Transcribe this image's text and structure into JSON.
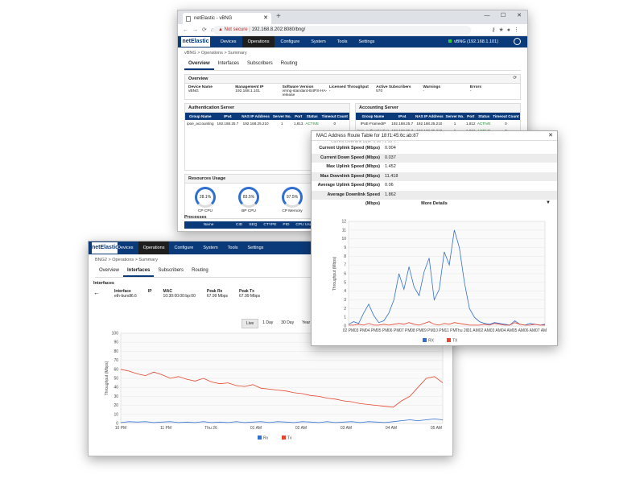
{
  "browser": {
    "tab_title": "netElastic - vBNG",
    "url_warning": "Not secure",
    "url": "192.168.8.202:8080/bng/"
  },
  "win1": {
    "logo": "netElastic",
    "menu": [
      "Devices",
      "Operations",
      "Configure",
      "System",
      "Tools",
      "Settings"
    ],
    "menu_active": 1,
    "device_link": "vBNG (192.168.1.101)",
    "breadcrumb": "vBNG > Operations > Summary",
    "tabs": [
      "Overview",
      "Interfaces",
      "Subscribers",
      "Routing"
    ],
    "overview_title": "Overview",
    "overview_cols": [
      {
        "label": "Device Name",
        "value": "vBNG"
      },
      {
        "label": "Management IP",
        "value": "192.168.1.101"
      },
      {
        "label": "Software Version",
        "value": "vmng-standard-B4PS-HA-release"
      },
      {
        "label": "Licensed Throughput",
        "value": "-"
      },
      {
        "label": "Active Subscribers",
        "value": "570"
      },
      {
        "label": "Warnings",
        "value": "-"
      },
      {
        "label": "Errors",
        "value": "-"
      }
    ],
    "auth_title": "Authentication Server",
    "auth_headers": [
      "Group Name",
      "IPv4",
      "NAS IP Address",
      "Server No.",
      "Port",
      "Status",
      "Timeout Count"
    ],
    "auth_rows": [
      [
        "ipoe_accounting",
        "192.168.25.7",
        "192.168.25.210",
        "1",
        "1,813",
        "ACTIVE",
        "0"
      ]
    ],
    "acct_title": "Accounting Server",
    "acct_headers": [
      "Group Name",
      "IPv4",
      "NAS IP Address",
      "Server No.",
      "Port",
      "Status",
      "Timeout Count"
    ],
    "acct_rows": [
      [
        "IPoE-FramedIP",
        "192.168.25.7",
        "192.168.25.210",
        "1",
        "1,812",
        "ACTIVE",
        "0"
      ],
      [
        "ipoe_authentication",
        "192.168.25.7",
        "192.168.25.210",
        "1",
        "1,812",
        "ACTIVE",
        "0"
      ]
    ],
    "resources_title": "Resources Usage",
    "gauges": [
      {
        "label": "CP CPU",
        "value": "28.1%"
      },
      {
        "label": "BP CPU",
        "value": "83.5%"
      },
      {
        "label": "CP Memory",
        "value": "97.5%"
      }
    ],
    "processes_title": "Processes",
    "process_headers": [
      "Name",
      "CID",
      "SEQ",
      "CTYPE",
      "PID",
      "CPU Usage (%)"
    ]
  },
  "win2": {
    "logo": "netElastic",
    "menu": [
      "Devices",
      "Operations",
      "Configure",
      "System",
      "Tools",
      "Settings"
    ],
    "menu_active": 1,
    "breadcrumb": "BNG2 > Operations > Summary",
    "tabs": [
      "Overview",
      "Interfaces",
      "Subscribers",
      "Routing"
    ],
    "section": "Interfaces",
    "iface_labels": [
      "Interface",
      "IP",
      "MAC",
      "Peak Rx",
      "Peak Tx"
    ],
    "iface_values": [
      "eth-bundl6.6",
      "",
      "10:30:00:00:bp:00",
      "67.99 Mbps",
      "67.99 Mbps"
    ],
    "ranges": [
      "Live",
      "1 Day",
      "30 Day",
      "Year"
    ],
    "range_active": 0
  },
  "win3": {
    "title": "MAC Address Route Table for 18:f1:45:6c:ab:87",
    "cut_text": "Current Downlink Byte: 0.00 71.18 T...",
    "stats": [
      {
        "label": "Current Uplink Speed (Mbps)",
        "value": "0.004"
      },
      {
        "label": "Current Down Speed (Mbps)",
        "value": "0.037"
      },
      {
        "label": "Max Uplink Speed (Mbps)",
        "value": "1.452"
      },
      {
        "label": "Max Downlink Speed (Mbps)",
        "value": "11.418"
      },
      {
        "label": "Average Uplink Speed (Mbps)",
        "value": "0.06"
      },
      {
        "label": "Average Downlink Speed (Mbps)",
        "value": "1.862"
      }
    ],
    "more_label": "More Details"
  },
  "chart_data": [
    {
      "type": "line",
      "title": "",
      "ylabel": "Throughput (Mbps)",
      "ylim": [
        0,
        100
      ],
      "yticks": [
        0,
        10,
        20,
        30,
        40,
        50,
        60,
        70,
        80,
        90,
        100
      ],
      "xtick_labels": [
        "10 PM",
        "11 PM",
        "Thu 26",
        "01 AM",
        "02 AM",
        "03 AM",
        "04 AM",
        "05 AM"
      ],
      "legend": [
        "Rx",
        "Tx"
      ],
      "legend_position": "bottom",
      "series": [
        {
          "name": "Rx",
          "color": "#2f6fd0",
          "values": [
            1,
            2,
            1.5,
            2,
            1,
            1.5,
            2,
            1,
            1.5,
            1,
            2,
            1,
            1.5,
            1,
            2,
            1,
            1.5,
            2,
            1,
            2,
            1.5,
            1,
            2,
            1.5,
            1,
            2,
            1,
            1.5,
            2,
            1,
            2,
            1.5,
            1,
            2,
            3,
            4,
            3,
            4,
            5,
            4
          ]
        },
        {
          "name": "Tx",
          "color": "#e8452c",
          "values": [
            60,
            58,
            55,
            53,
            57,
            54,
            50,
            52,
            49,
            47,
            50,
            46,
            44,
            45,
            42,
            41,
            43,
            39,
            38,
            37,
            36,
            34,
            33,
            31,
            30,
            28,
            27,
            25,
            24,
            22,
            21,
            20,
            19,
            18,
            25,
            30,
            40,
            50,
            52,
            45
          ]
        }
      ]
    },
    {
      "type": "line",
      "title": "",
      "ylabel": "Throughput (Mbps)",
      "ylim": [
        0,
        12
      ],
      "yticks": [
        0,
        1,
        2,
        3,
        4,
        5,
        6,
        7,
        8,
        9,
        10,
        11,
        12
      ],
      "xtick_labels": [
        "02 PM",
        "03 PM",
        "04 PM",
        "05 PM",
        "06 PM",
        "07 PM",
        "08 PM",
        "09 PM",
        "10 PM",
        "11 PM",
        "Thu 26",
        "01 AM",
        "02 AM",
        "03 AM",
        "04 AM",
        "05 AM",
        "06 AM",
        "07 AM"
      ],
      "legend": [
        "RX",
        "TX"
      ],
      "legend_position": "bottom",
      "series": [
        {
          "name": "RX",
          "color": "#2f6fd0",
          "values": [
            0.2,
            0.5,
            0.3,
            1.5,
            2.5,
            1.2,
            0.4,
            0.6,
            1.5,
            3.0,
            6.0,
            4.2,
            6.8,
            4.5,
            3.5,
            6.2,
            7.8,
            3.0,
            4.2,
            8.5,
            7.0,
            11.0,
            9.0,
            5.0,
            2.0,
            1.0,
            0.5,
            0.3,
            0.2,
            0.4,
            0.3,
            0.2,
            0.1,
            0.6,
            0.2,
            0.1,
            0.3,
            0.2,
            0.1,
            0.2
          ]
        },
        {
          "name": "TX",
          "color": "#e8452c",
          "values": [
            0.1,
            0.1,
            0.2,
            0.1,
            0.3,
            0.1,
            0.1,
            0.2,
            0.1,
            0.2,
            0.3,
            0.2,
            0.4,
            0.2,
            0.1,
            0.3,
            0.5,
            0.2,
            0.1,
            0.3,
            0.2,
            0.4,
            0.3,
            0.2,
            0.1,
            0.1,
            0.1,
            0.2,
            0.1,
            0.3,
            0.2,
            0.1,
            0.1,
            0.4,
            0.2,
            0.1,
            0.1,
            0.2,
            0.1,
            0.1
          ]
        }
      ]
    }
  ]
}
